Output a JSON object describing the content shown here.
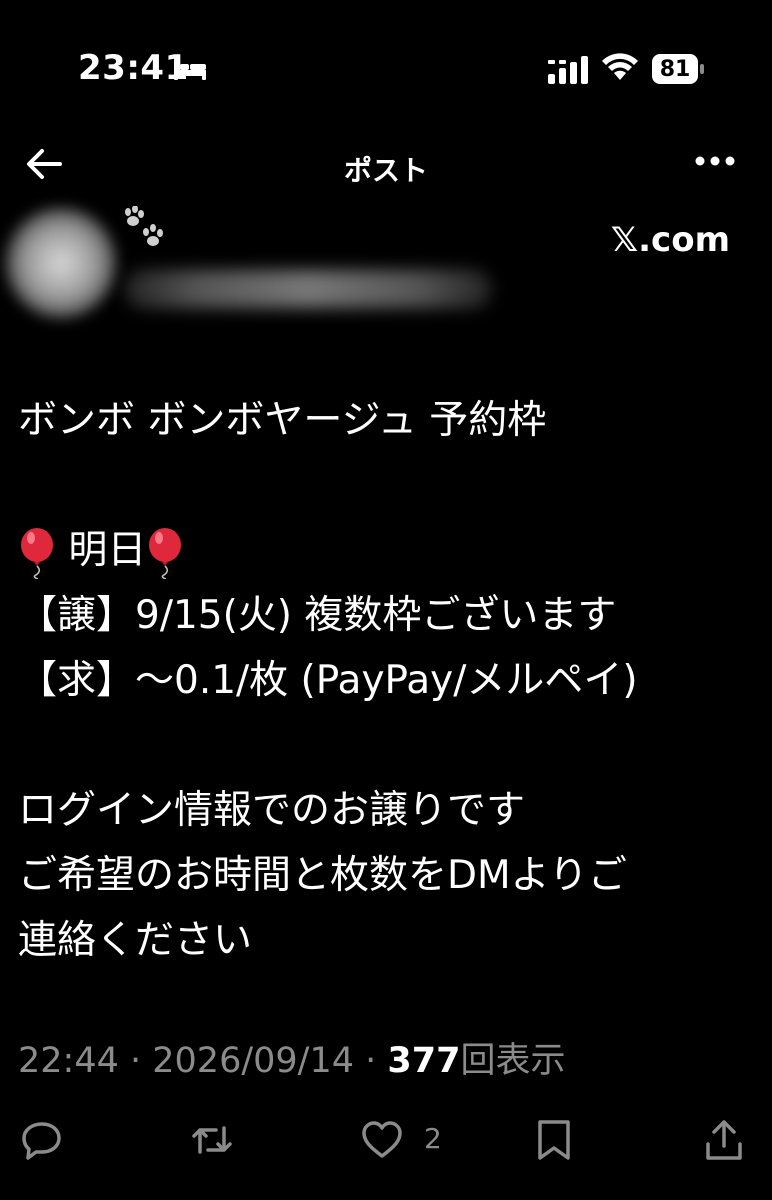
{
  "status_bar": {
    "time": "23:41",
    "battery": "81",
    "icons": [
      "bed-icon",
      "signal-icon",
      "wifi-icon",
      "battery-icon"
    ]
  },
  "nav": {
    "title": "ポスト",
    "icons": [
      "back-arrow-icon",
      "more-icon"
    ]
  },
  "author": {
    "brand": "𝕏.com",
    "avatar_blurred": true,
    "handle_blurred": true
  },
  "post": {
    "line1": "ボンボ ボンボヤージュ 予約枠",
    "line2": " 明日",
    "line3": "【譲】9/15(火) 複数枠ございます",
    "line4": "【求】〜0.1/枚 (PayPay/メルペイ)",
    "line5": "ログイン情報でのお譲りです",
    "line6": "ご希望のお時間と枚数をDMよりご",
    "line7": "連絡ください"
  },
  "meta": {
    "time": "22:44",
    "date": "2026/09/14",
    "views_count": "377",
    "views_label": "回表示"
  },
  "actions": {
    "like_count": "2",
    "icons": [
      "reply-icon",
      "repost-icon",
      "like-icon",
      "bookmark-icon",
      "share-icon"
    ]
  },
  "colors": {
    "background": "#000000",
    "text": "#ffffff",
    "muted": "#8b8b8b",
    "balloon": "#e0283c"
  }
}
